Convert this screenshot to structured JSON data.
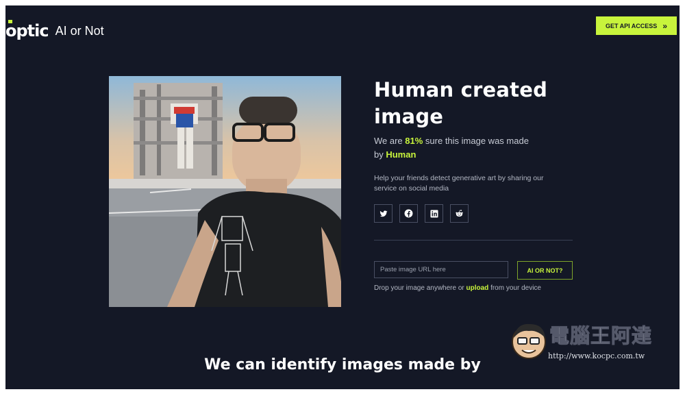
{
  "header": {
    "logo_text": "optic",
    "logo_subtitle": "AI or Not",
    "api_button_label": "GET API ACCESS",
    "api_button_icon": "double-chevron-right-icon"
  },
  "result": {
    "title_line1": "Human created",
    "title_line2": "image",
    "sure_prefix": "We are ",
    "confidence": "81%",
    "sure_middle": " sure this image was made",
    "sure_by": "by ",
    "verdict": "Human",
    "share_text": "Help your friends detect generative art by sharing our service on social media",
    "socials": [
      "twitter-icon",
      "facebook-icon",
      "linkedin-icon",
      "reddit-icon"
    ]
  },
  "upload": {
    "url_placeholder": "Paste image URL here",
    "submit_label": "AI OR NOT?",
    "drop_prefix": "Drop your image anywhere or ",
    "drop_link": "upload",
    "drop_suffix": " from your device"
  },
  "bottom": {
    "heading": "We can identify images made by"
  },
  "watermark": {
    "text": "電腦王阿達",
    "url": "http://www.kocpc.com.tw"
  },
  "colors": {
    "background": "#141826",
    "accent": "#c8f43c",
    "text": "#ffffff",
    "muted": "#b3b8c4"
  }
}
